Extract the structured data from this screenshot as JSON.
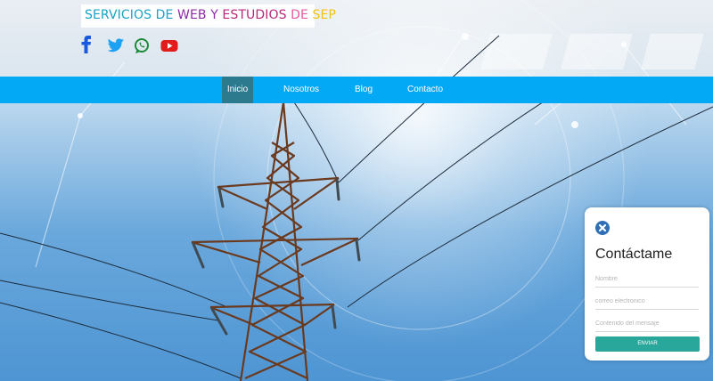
{
  "logo": {
    "parts": [
      {
        "text": "SERVICIOS DE ",
        "color": "#1ba2c7"
      },
      {
        "text": "WEB ",
        "color": "#8e2aa6"
      },
      {
        "text": "Y ",
        "color": "#8e2aa6"
      },
      {
        "text": "ESTUDIOS ",
        "color": "#b8287a"
      },
      {
        "text": "DE ",
        "color": "#e65aa0"
      },
      {
        "text": "SEP",
        "color": "#f2c114"
      }
    ]
  },
  "social": [
    {
      "icon": "facebook-icon",
      "color": "#1a5ae0"
    },
    {
      "icon": "twitter-icon",
      "color": "#1da1f2"
    },
    {
      "icon": "whatsapp-icon",
      "color": "#1d8a3a"
    },
    {
      "icon": "youtube-icon",
      "color": "#e01c1c"
    }
  ],
  "nav": {
    "items": [
      "Inicio",
      "Nosotros",
      "Blog",
      "Contacto"
    ],
    "active": "Inicio",
    "bar_color": "#03a9f4",
    "active_color": "#2b7a8e"
  },
  "contact": {
    "title": "Contáctame",
    "name_placeholder": "Nombre",
    "email_placeholder": "correo electronico",
    "message_placeholder": "Contenido del mensaje",
    "send_label": "ENVIAR",
    "close_icon": "close-icon",
    "button_color": "#2aa79b"
  }
}
